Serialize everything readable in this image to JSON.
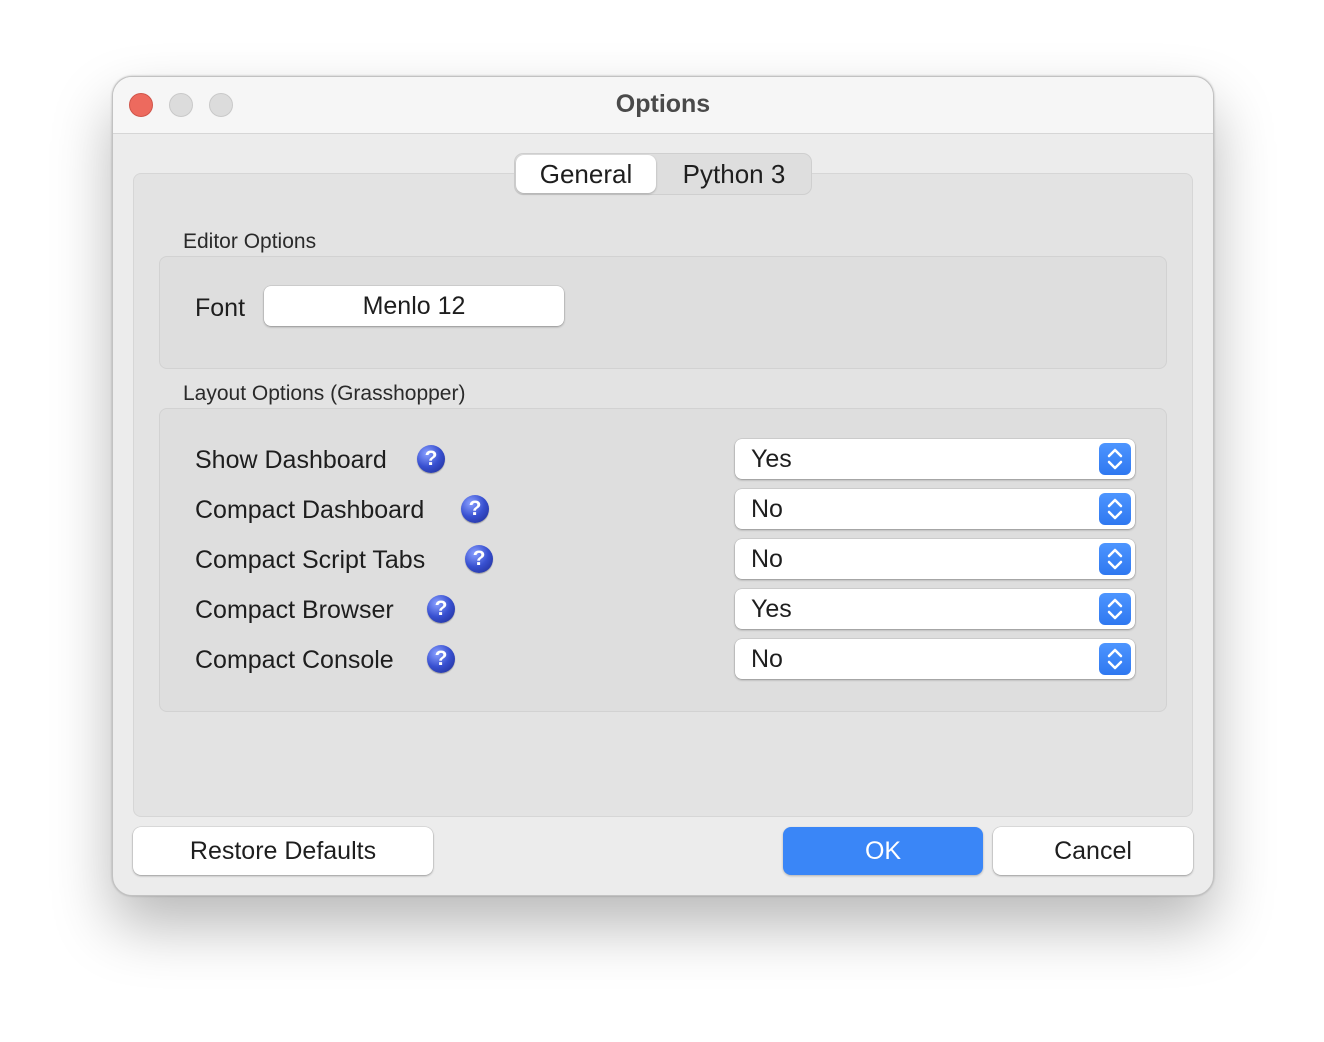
{
  "window": {
    "title": "Options"
  },
  "tabs": [
    {
      "label": "General",
      "selected": true
    },
    {
      "label": "Python 3",
      "selected": false
    }
  ],
  "editor_options": {
    "group_label": "Editor Options",
    "font_label": "Font",
    "font_value": "Menlo 12"
  },
  "layout_options": {
    "group_label": "Layout Options (Grasshopper)",
    "help_glyph": "?",
    "items": [
      {
        "label": "Show Dashboard",
        "value": "Yes"
      },
      {
        "label": "Compact Dashboard",
        "value": "No"
      },
      {
        "label": "Compact Script Tabs",
        "value": "No"
      },
      {
        "label": "Compact Browser",
        "value": "Yes"
      },
      {
        "label": "Compact Console",
        "value": "No"
      }
    ]
  },
  "buttons": {
    "restore_defaults": "Restore Defaults",
    "ok": "OK",
    "cancel": "Cancel"
  },
  "colors": {
    "accent": "#3a86f7",
    "close": "#ed6a5e",
    "help_icon": "#3850d0"
  },
  "icons": {
    "help": "help-icon",
    "select_arrows": "chevron-up-down-icon"
  }
}
